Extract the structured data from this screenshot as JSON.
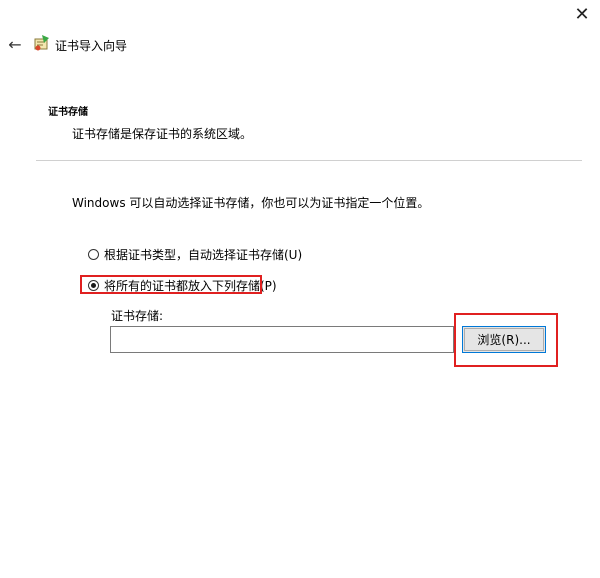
{
  "window": {
    "close_label": "✕"
  },
  "header": {
    "back_label": "←",
    "title": "证书导入向导"
  },
  "section": {
    "heading": "证书存储",
    "description": "证书存储是保存证书的系统区域。"
  },
  "main": {
    "intro": "Windows 可以自动选择证书存储，你也可以为证书指定一个位置。",
    "option_auto": "根据证书类型，自动选择证书存储(U)",
    "option_manual": "将所有的证书都放入下列存储(P)",
    "option_selected": "manual",
    "store_label": "证书存储:",
    "store_value": "",
    "browse_label": "浏览(R)..."
  },
  "annotations": {
    "highlight_color": "#e02020"
  },
  "icons": {
    "back": "back-arrow-icon",
    "close": "close-icon",
    "wizard": "certificate-wizard-icon"
  }
}
